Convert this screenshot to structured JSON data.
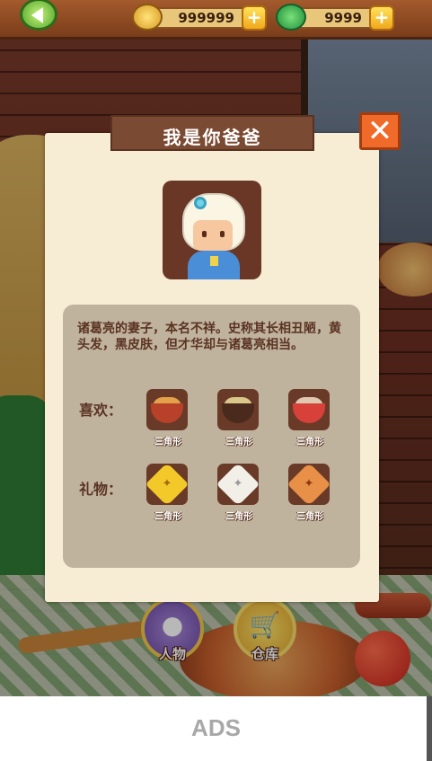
{
  "topbar": {
    "coins": "999999",
    "gems": "9999",
    "plus": "+"
  },
  "bottom_nav": {
    "people": "人物",
    "storage": "仓库"
  },
  "ads": "ADS",
  "dialog": {
    "title": "我是你爸爸",
    "close_symbol": "✕",
    "description": "诸葛亮的妻子，本名不祥。史称其长相丑陋，黄头发，黑皮肤，但才华却与诸葛亮相当。",
    "likes_label": "喜欢：",
    "gifts_label": "礼物：",
    "likes": [
      {
        "caption": "三角形",
        "icon": "noodle-bowl-icon"
      },
      {
        "caption": "三角形",
        "icon": "soup-bowl-icon"
      },
      {
        "caption": "三角形",
        "icon": "meat-bowl-icon"
      }
    ],
    "gifts": [
      {
        "caption": "三角形",
        "icon": "yellow-triangle-snack-icon"
      },
      {
        "caption": "三角形",
        "icon": "white-triangle-snack-icon"
      },
      {
        "caption": "三角形",
        "icon": "orange-triangle-snack-icon"
      }
    ]
  },
  "colors": {
    "dialog_bg": "#f7ecd4",
    "title_bg": "#7b4a33",
    "panel_bg": "#c0b39e",
    "close_bg": "#f06a2a",
    "text_brown": "#5a3322"
  }
}
